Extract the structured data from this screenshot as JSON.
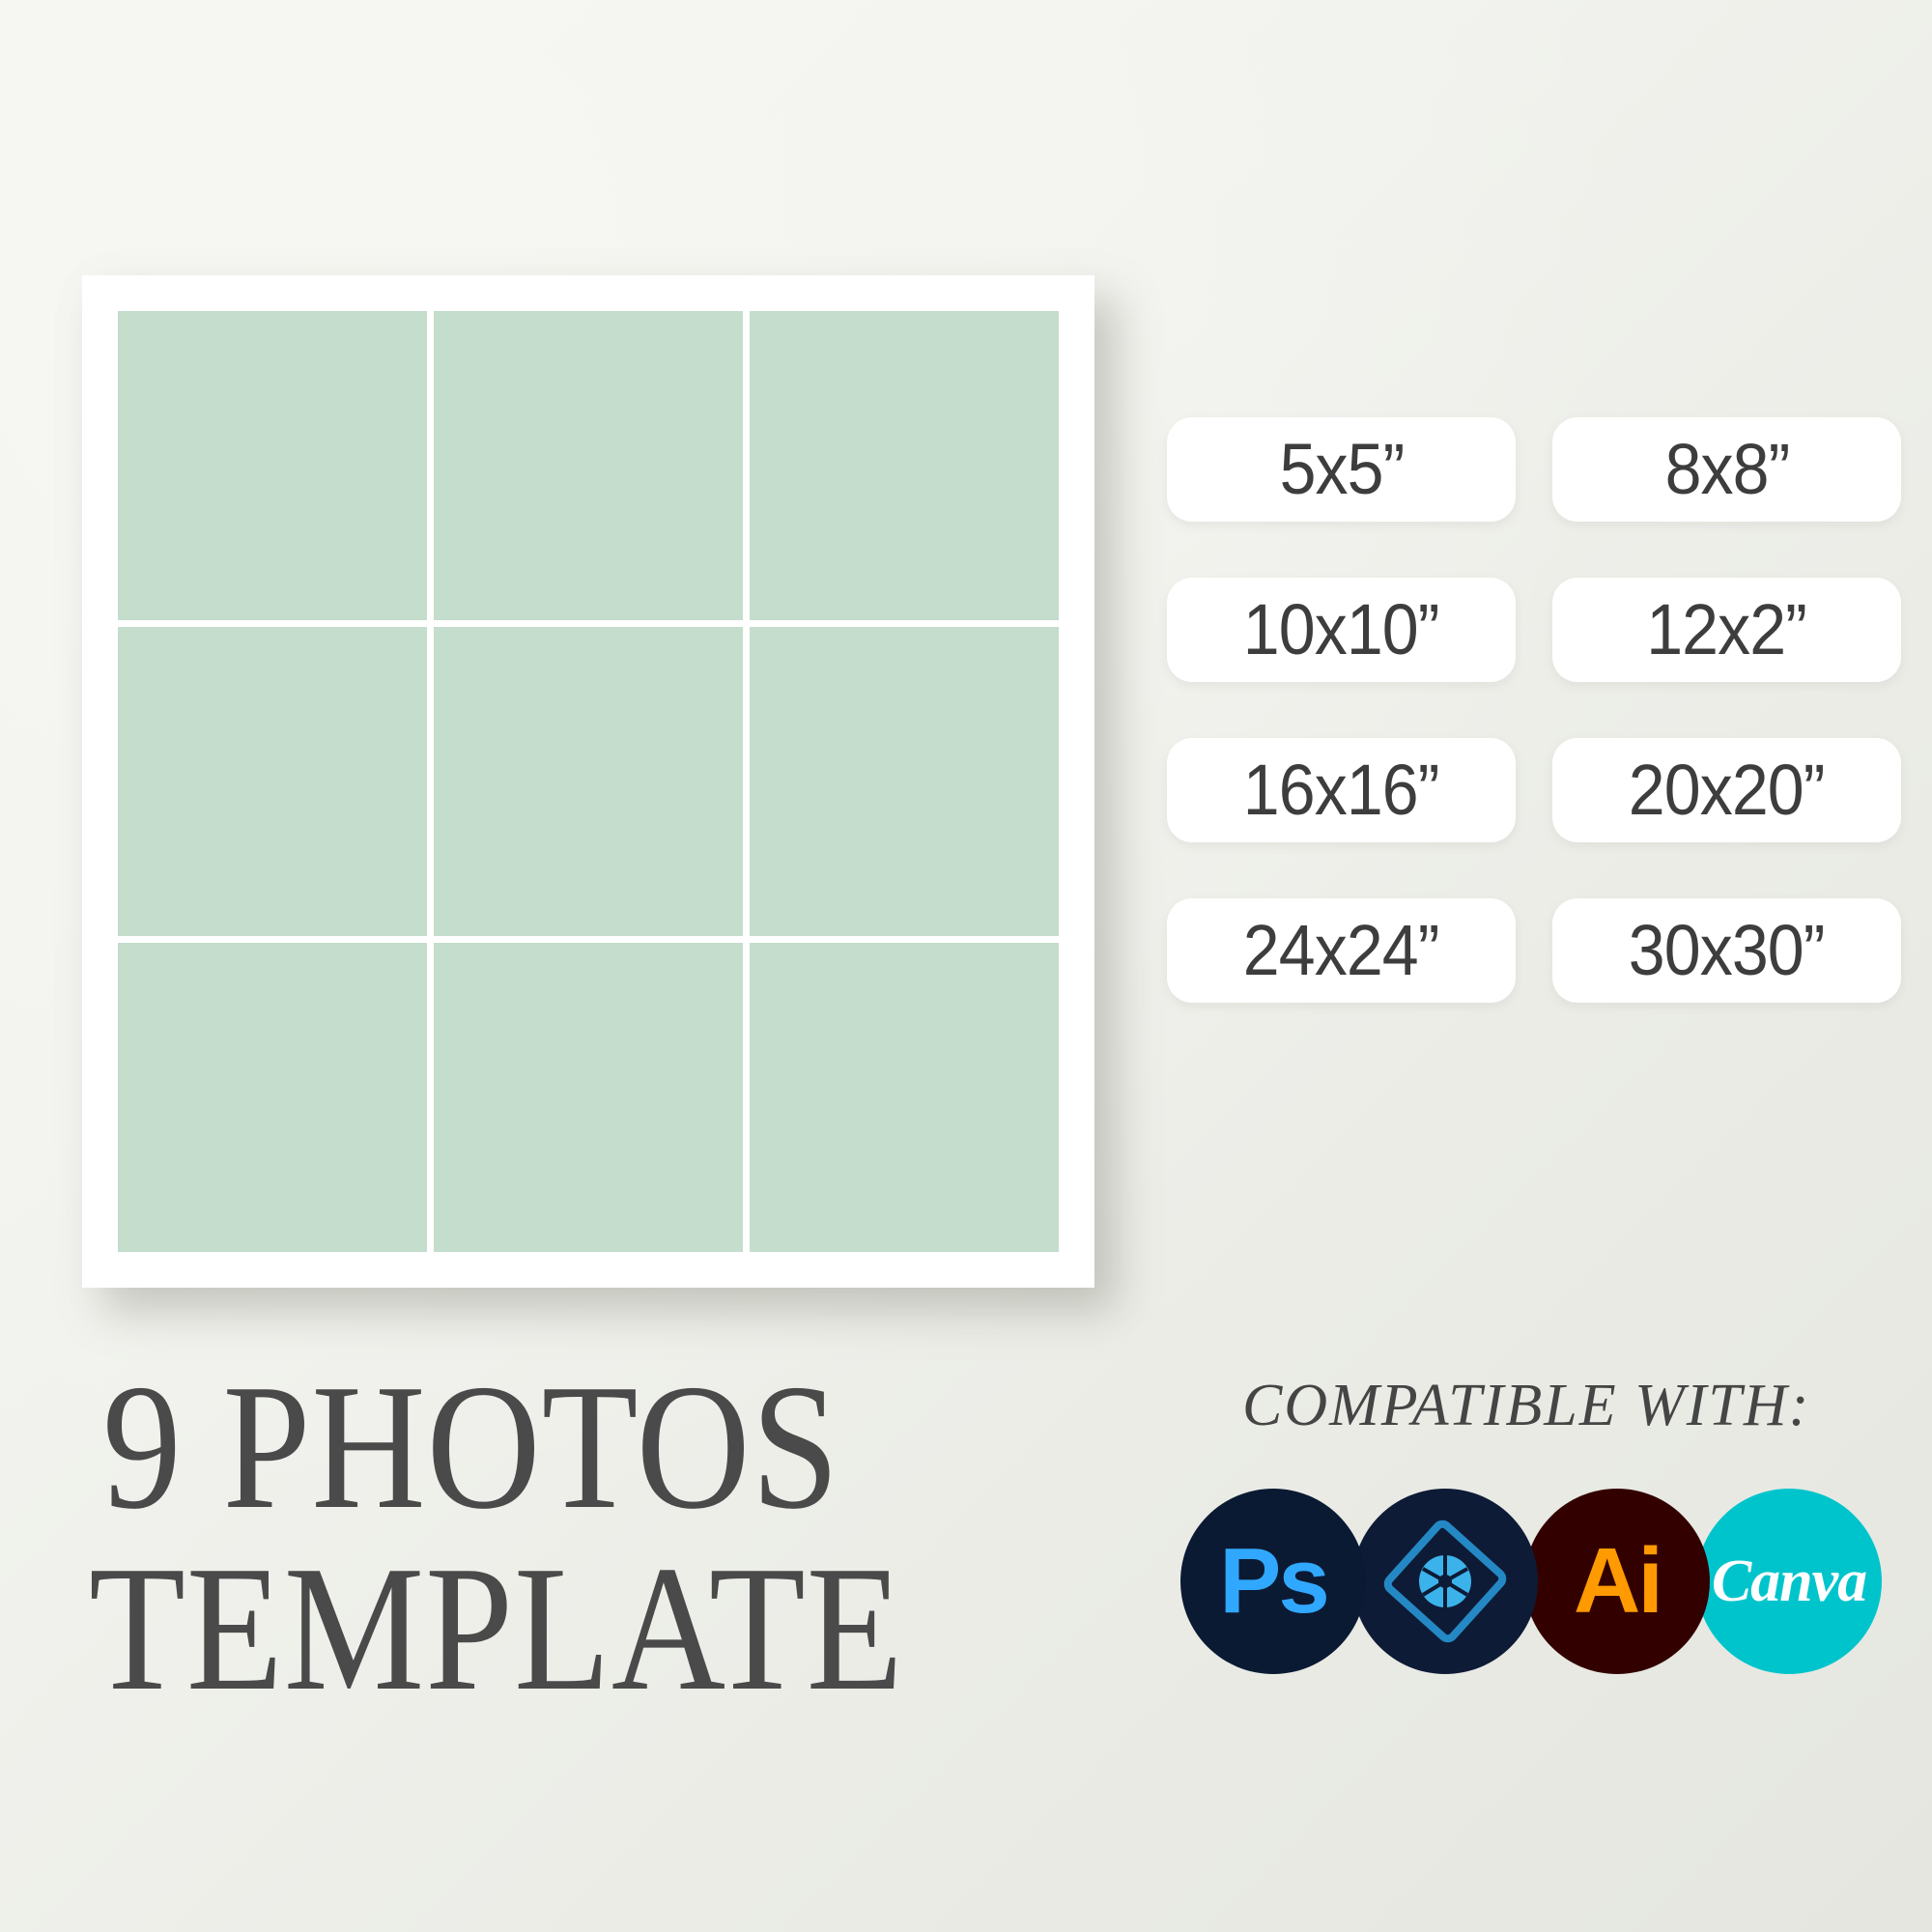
{
  "background": {
    "color_light": "#F5F5F1",
    "color_dark": "#E5E6E0"
  },
  "collage": {
    "frame_color": "#FFFFFF",
    "photo_color": "#C4DDCC",
    "rows": 3,
    "columns": 3,
    "cells": [
      {
        "id": "photo-1"
      },
      {
        "id": "photo-2"
      },
      {
        "id": "photo-3"
      },
      {
        "id": "photo-4"
      },
      {
        "id": "photo-5"
      },
      {
        "id": "photo-6"
      },
      {
        "id": "photo-7"
      },
      {
        "id": "photo-8"
      },
      {
        "id": "photo-9"
      }
    ]
  },
  "sizes": {
    "text_color": "#3D3D3D",
    "badge_color": "#FFFFFF",
    "items": [
      {
        "label": "5x5”"
      },
      {
        "label": "8x8”"
      },
      {
        "label": "10x10”"
      },
      {
        "label": "12x2”"
      },
      {
        "label": "16x16”"
      },
      {
        "label": "20x20”"
      },
      {
        "label": "24x24”"
      },
      {
        "label": "30x30”"
      }
    ]
  },
  "title": {
    "line1": "9 PHOTOS",
    "line2": "TEMPLATE",
    "color": "#4A4A4A"
  },
  "compatible": {
    "heading": "COMPATIBLE WITH:",
    "heading_color": "#454545",
    "apps": [
      {
        "name": "Adobe Photoshop",
        "icon": "photoshop-icon",
        "glyph": "Ps",
        "bg": "#0B1A33",
        "fg": "#31A8FF"
      },
      {
        "name": "Adobe Photoshop Elements",
        "icon": "photoshop-elements-icon",
        "glyph": "",
        "bg": "#0E1B36",
        "fg": "#2488C4"
      },
      {
        "name": "Adobe Illustrator",
        "icon": "illustrator-icon",
        "glyph": "Ai",
        "bg": "#330000",
        "fg": "#FF9A00"
      },
      {
        "name": "Canva",
        "icon": "canva-icon",
        "glyph": "Canva",
        "bg": "#00C4CC",
        "fg": "#FFFFFF"
      }
    ]
  }
}
